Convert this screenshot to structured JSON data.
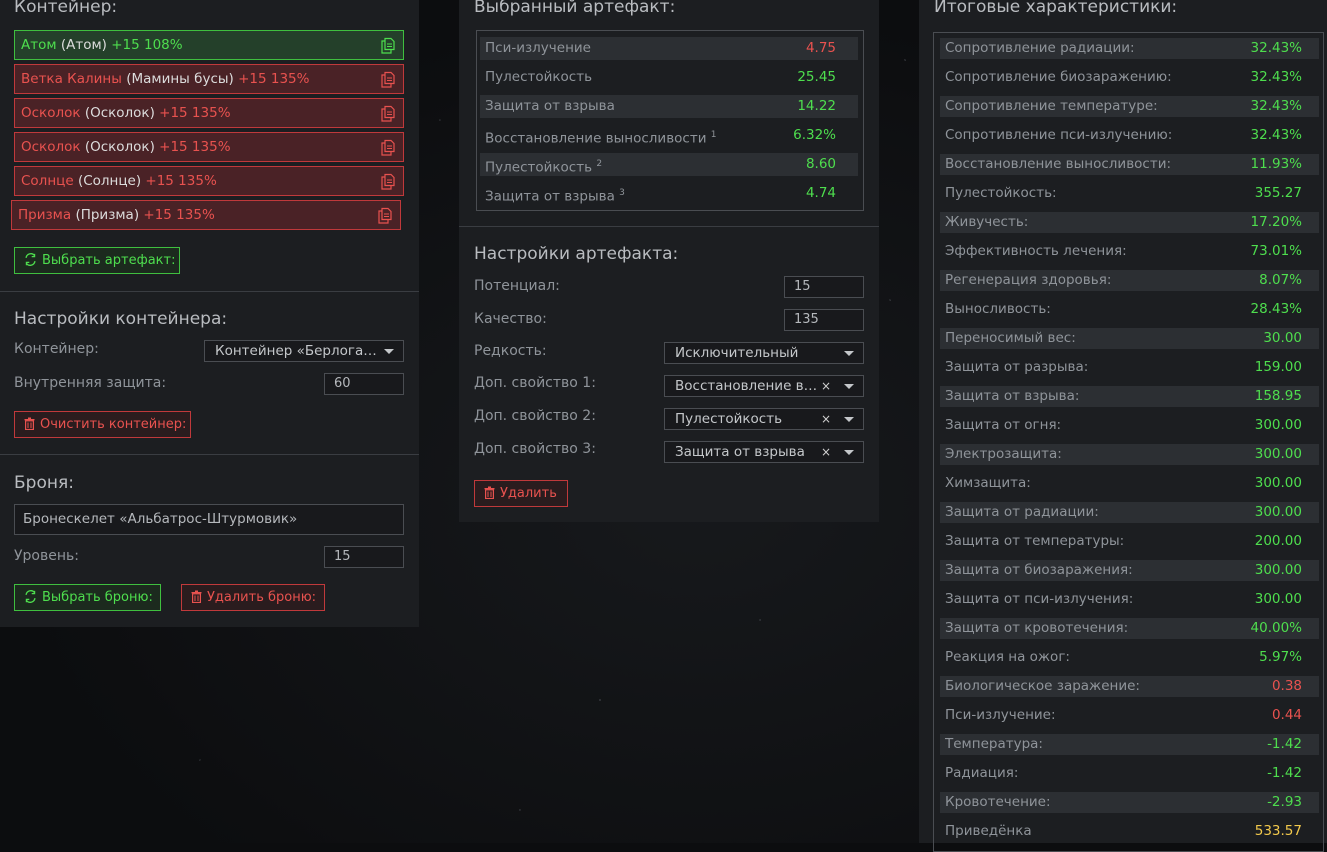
{
  "container": {
    "title": "Контейнер:",
    "slots": [
      {
        "name": "Атом",
        "orig": "(Атом)",
        "level": "+15 108%",
        "state": "green"
      },
      {
        "name": "Ветка Калины",
        "orig": "(Мамины бусы)",
        "level": "+15 135%",
        "state": "red"
      },
      {
        "name": "Осколок",
        "orig": "(Осколок)",
        "level": "+15 135%",
        "state": "red"
      },
      {
        "name": "Осколок",
        "orig": "(Осколок)",
        "level": "+15 135%",
        "state": "red"
      },
      {
        "name": "Солнце",
        "orig": "(Солнце)",
        "level": "+15 135%",
        "state": "red"
      },
      {
        "name": "Призма",
        "orig": "(Призма)",
        "level": "+15 135%",
        "state": "red"
      }
    ],
    "select_artifact_button": "Выбрать артефакт:",
    "settings_title": "Настройки контейнера:",
    "container_label": "Контейнер:",
    "container_value": "Контейнер «Берлога…",
    "inner_protection_label": "Внутренняя защита:",
    "inner_protection_value": "60",
    "clear_button": "Очистить контейнер:"
  },
  "armor": {
    "title": "Броня:",
    "name_value": "Бронескелет «Альбатрос-Штурмовик»",
    "level_label": "Уровень:",
    "level_value": "15",
    "select_button": "Выбрать броню:",
    "delete_button": "Удалить броню:"
  },
  "artifact": {
    "title": "Выбранный артефакт:",
    "stats": [
      {
        "name": "Пси-излучение",
        "sup": "",
        "value": "4.75",
        "color": "red"
      },
      {
        "name": "Пулестойкость",
        "sup": "",
        "value": "25.45",
        "color": "green"
      },
      {
        "name": "Защита от взрыва",
        "sup": "",
        "value": "14.22",
        "color": "green"
      },
      {
        "name": "Восстановление выносливости",
        "sup": "1",
        "value": "6.32%",
        "color": "green"
      },
      {
        "name": "Пулестойкость",
        "sup": "2",
        "value": "8.60",
        "color": "green"
      },
      {
        "name": "Защита от взрыва",
        "sup": "3",
        "value": "4.74",
        "color": "green"
      }
    ],
    "settings_title": "Настройки артефакта:",
    "potential_label": "Потенциал:",
    "potential_value": "15",
    "quality_label": "Качество:",
    "quality_value": "135",
    "rarity_label": "Редкость:",
    "rarity_value": "Исключительный",
    "extra1_label": "Доп. свойство 1:",
    "extra1_value": "Восстановление в…",
    "extra2_label": "Доп. свойство 2:",
    "extra2_value": "Пулестойкость",
    "extra3_label": "Доп. свойство 3:",
    "extra3_value": "Защита от взрыва",
    "clear_glyph": "×",
    "delete_button": "Удалить"
  },
  "totals": {
    "title": "Итоговые характеристики:",
    "rows": [
      {
        "name": "Сопротивление радиации:",
        "value": "32.43%",
        "color": "green"
      },
      {
        "name": "Сопротивление биозаражению:",
        "value": "32.43%",
        "color": "green"
      },
      {
        "name": "Сопротивление температуре:",
        "value": "32.43%",
        "color": "green"
      },
      {
        "name": "Сопротивление пси-излучению:",
        "value": "32.43%",
        "color": "green"
      },
      {
        "name": "Восстановление выносливости:",
        "value": "11.93%",
        "color": "green"
      },
      {
        "name": "Пулестойкость:",
        "value": "355.27",
        "color": "green"
      },
      {
        "name": "Живучесть:",
        "value": "17.20%",
        "color": "green"
      },
      {
        "name": "Эффективность лечения:",
        "value": "73.01%",
        "color": "green"
      },
      {
        "name": "Регенерация здоровья:",
        "value": "8.07%",
        "color": "green"
      },
      {
        "name": "Выносливость:",
        "value": "28.43%",
        "color": "green"
      },
      {
        "name": "Переносимый вес:",
        "value": "30.00",
        "color": "green"
      },
      {
        "name": "Защита от разрыва:",
        "value": "159.00",
        "color": "green"
      },
      {
        "name": "Защита от взрыва:",
        "value": "158.95",
        "color": "green"
      },
      {
        "name": "Защита от огня:",
        "value": "300.00",
        "color": "green"
      },
      {
        "name": "Электрозащита:",
        "value": "300.00",
        "color": "green"
      },
      {
        "name": "Химзащита:",
        "value": "300.00",
        "color": "green"
      },
      {
        "name": "Защита от радиации:",
        "value": "300.00",
        "color": "green"
      },
      {
        "name": "Защита от температуры:",
        "value": "200.00",
        "color": "green"
      },
      {
        "name": "Защита от биозаражения:",
        "value": "300.00",
        "color": "green"
      },
      {
        "name": "Защита от пси-излучения:",
        "value": "300.00",
        "color": "green"
      },
      {
        "name": "Защита от кровотечения:",
        "value": "40.00%",
        "color": "green"
      },
      {
        "name": "Реакция на ожог:",
        "value": "5.97%",
        "color": "green"
      },
      {
        "name": "Биологическое заражение:",
        "value": "0.38",
        "color": "red"
      },
      {
        "name": "Пси-излучение:",
        "value": "0.44",
        "color": "red"
      },
      {
        "name": "Температура:",
        "value": "-1.42",
        "color": "green"
      },
      {
        "name": "Радиация:",
        "value": "-1.42",
        "color": "green"
      },
      {
        "name": "Кровотечение:",
        "value": "-2.93",
        "color": "green"
      },
      {
        "name": "Приведёнка",
        "value": "533.57",
        "color": "yellow"
      }
    ]
  },
  "colors": {
    "green": "#4ede4e",
    "red": "#e8524f",
    "yellow": "#f2c94c",
    "panel": "#1c1e21"
  },
  "icons": {
    "slot": "copy-icon",
    "select": "refresh-icon",
    "delete": "trash-icon",
    "dropdown": "caret-down-icon"
  }
}
